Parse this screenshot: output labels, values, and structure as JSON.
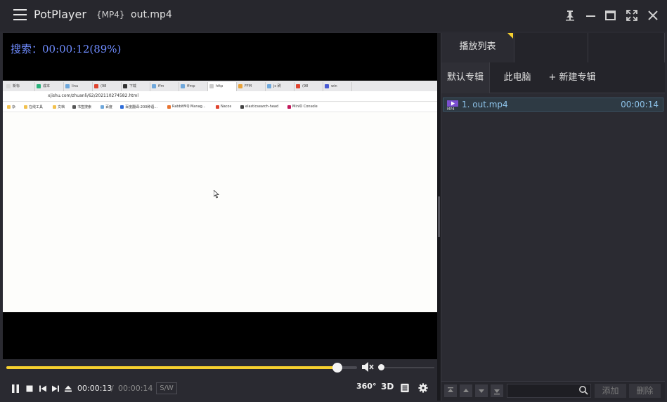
{
  "app": {
    "name": "PotPlayer",
    "format_tag": "{MP4}",
    "file_title": "out.mp4"
  },
  "osd": {
    "seek_text": "搜索：00:00:12(89%)"
  },
  "browser_frame": {
    "tabs": [
      "新标",
      "成本",
      "linu",
      "(98",
      "下载",
      "ffm",
      "ffmp",
      "http",
      "FFM",
      "js 刷",
      "(98",
      "win"
    ],
    "url": "xjishu.com/zhuanli/62/202110274582.html",
    "bookmarks": [
      "杂",
      "在线工具",
      "文档",
      "书签搜索",
      "百度",
      "百度翻译-200种语...",
      "RabbitMQ Manag...",
      "Nacos",
      "elasticsearch-head",
      "MinIO Console"
    ]
  },
  "playback": {
    "progress": 0.943,
    "volume": 0.0,
    "current_time": "00:00:13",
    "separator": "/",
    "total_time": "00:00:14",
    "sw_label": "S/W",
    "btn_360": "360°",
    "btn_3d": "3D"
  },
  "playlist": {
    "tab_label": "播放列表",
    "subtabs": [
      "默认专辑",
      "此电脑",
      "+ 新建专辑"
    ],
    "items": [
      {
        "name": "1. out.mp4",
        "duration": "00:00:14"
      }
    ],
    "add_label": "添加",
    "delete_label": "删除"
  },
  "colors": {
    "accent": "#f6d02f",
    "osd": "#6f8cff",
    "playlist_text": "#8ec3ea"
  }
}
